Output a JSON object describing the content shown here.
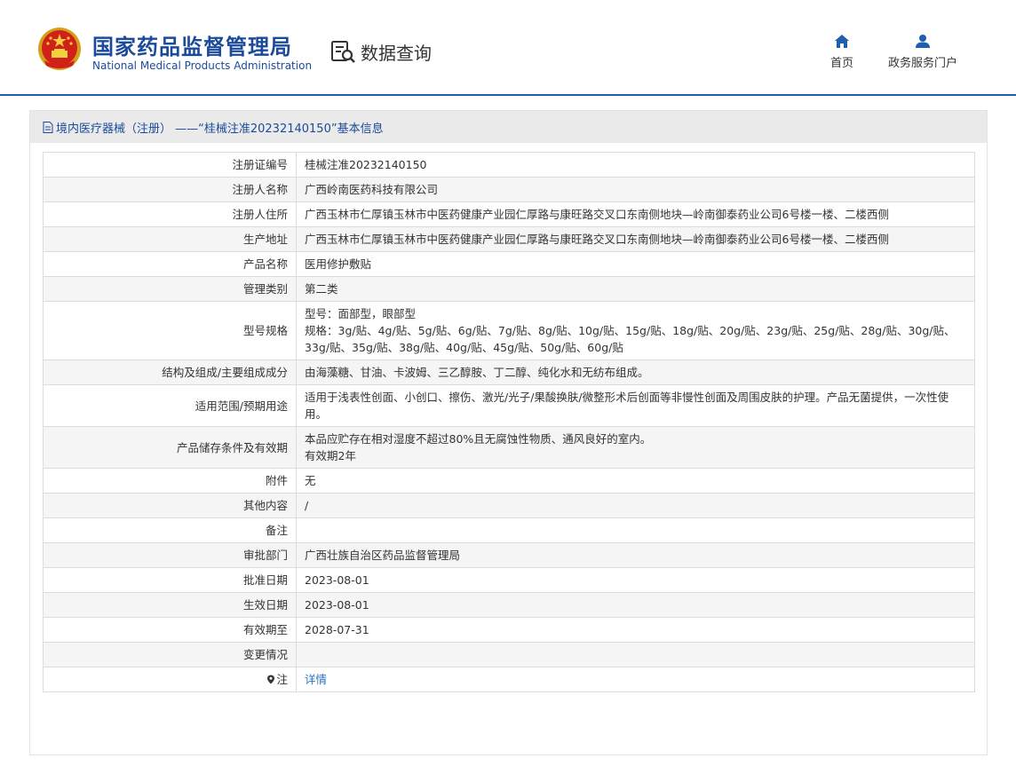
{
  "header": {
    "org_cn": "国家药品监督管理局",
    "org_en": "National Medical Products Administration",
    "query_label": "数据查询",
    "nav": {
      "home_label": "首页",
      "service_label": "政务服务门户"
    }
  },
  "panel": {
    "title": "境内医疗器械（注册） ——“桂械注准20232140150”基本信息"
  },
  "rows": [
    {
      "key": "注册证编号",
      "value": "桂械注准20232140150"
    },
    {
      "key": "注册人名称",
      "value": "广西岭南医药科技有限公司"
    },
    {
      "key": "注册人住所",
      "value": "广西玉林市仁厚镇玉林市中医药健康产业园仁厚路与康旺路交叉口东南侧地块—岭南御泰药业公司6号楼一楼、二楼西侧"
    },
    {
      "key": "生产地址",
      "value": "广西玉林市仁厚镇玉林市中医药健康产业园仁厚路与康旺路交叉口东南侧地块—岭南御泰药业公司6号楼一楼、二楼西侧"
    },
    {
      "key": "产品名称",
      "value": "医用修护敷贴"
    },
    {
      "key": "管理类别",
      "value": "第二类"
    },
    {
      "key": "型号规格",
      "value_lines": [
        "型号：面部型，眼部型",
        "规格：3g/贴、4g/贴、5g/贴、6g/贴、7g/贴、8g/贴、10g/贴、15g/贴、18g/贴、20g/贴、23g/贴、25g/贴、28g/贴、30g/贴、",
        "33g/贴、35g/贴、38g/贴、40g/贴、45g/贴、50g/贴、60g/贴"
      ]
    },
    {
      "key": "结构及组成/主要组成成分",
      "value": "由海藻糖、甘油、卡波姆、三乙醇胺、丁二醇、纯化水和无纺布组成。"
    },
    {
      "key": "适用范围/预期用途",
      "value_lines": [
        "适用于浅表性创面、小创口、擦伤、激光/光子/果酸换肤/微整形术后创面等非慢性创面及周围皮肤的护理。产品无菌提供，一次性使",
        "用。"
      ]
    },
    {
      "key": "产品储存条件及有效期",
      "value_lines": [
        "本品应贮存在相对湿度不超过80%且无腐蚀性物质、通风良好的室内。",
        "有效期2年"
      ]
    },
    {
      "key": "附件",
      "value": "无"
    },
    {
      "key": "其他内容",
      "value": "/"
    },
    {
      "key": "备注",
      "value": ""
    },
    {
      "key": "审批部门",
      "value": "广西壮族自治区药品监督管理局"
    },
    {
      "key": "批准日期",
      "value": "2023-08-01"
    },
    {
      "key": "生效日期",
      "value": "2023-08-01"
    },
    {
      "key": "有效期至",
      "value": "2028-07-31"
    },
    {
      "key": "变更情况",
      "value": ""
    },
    {
      "key": "注",
      "value": "详情",
      "key_icon": "location-pin-icon"
    }
  ]
}
